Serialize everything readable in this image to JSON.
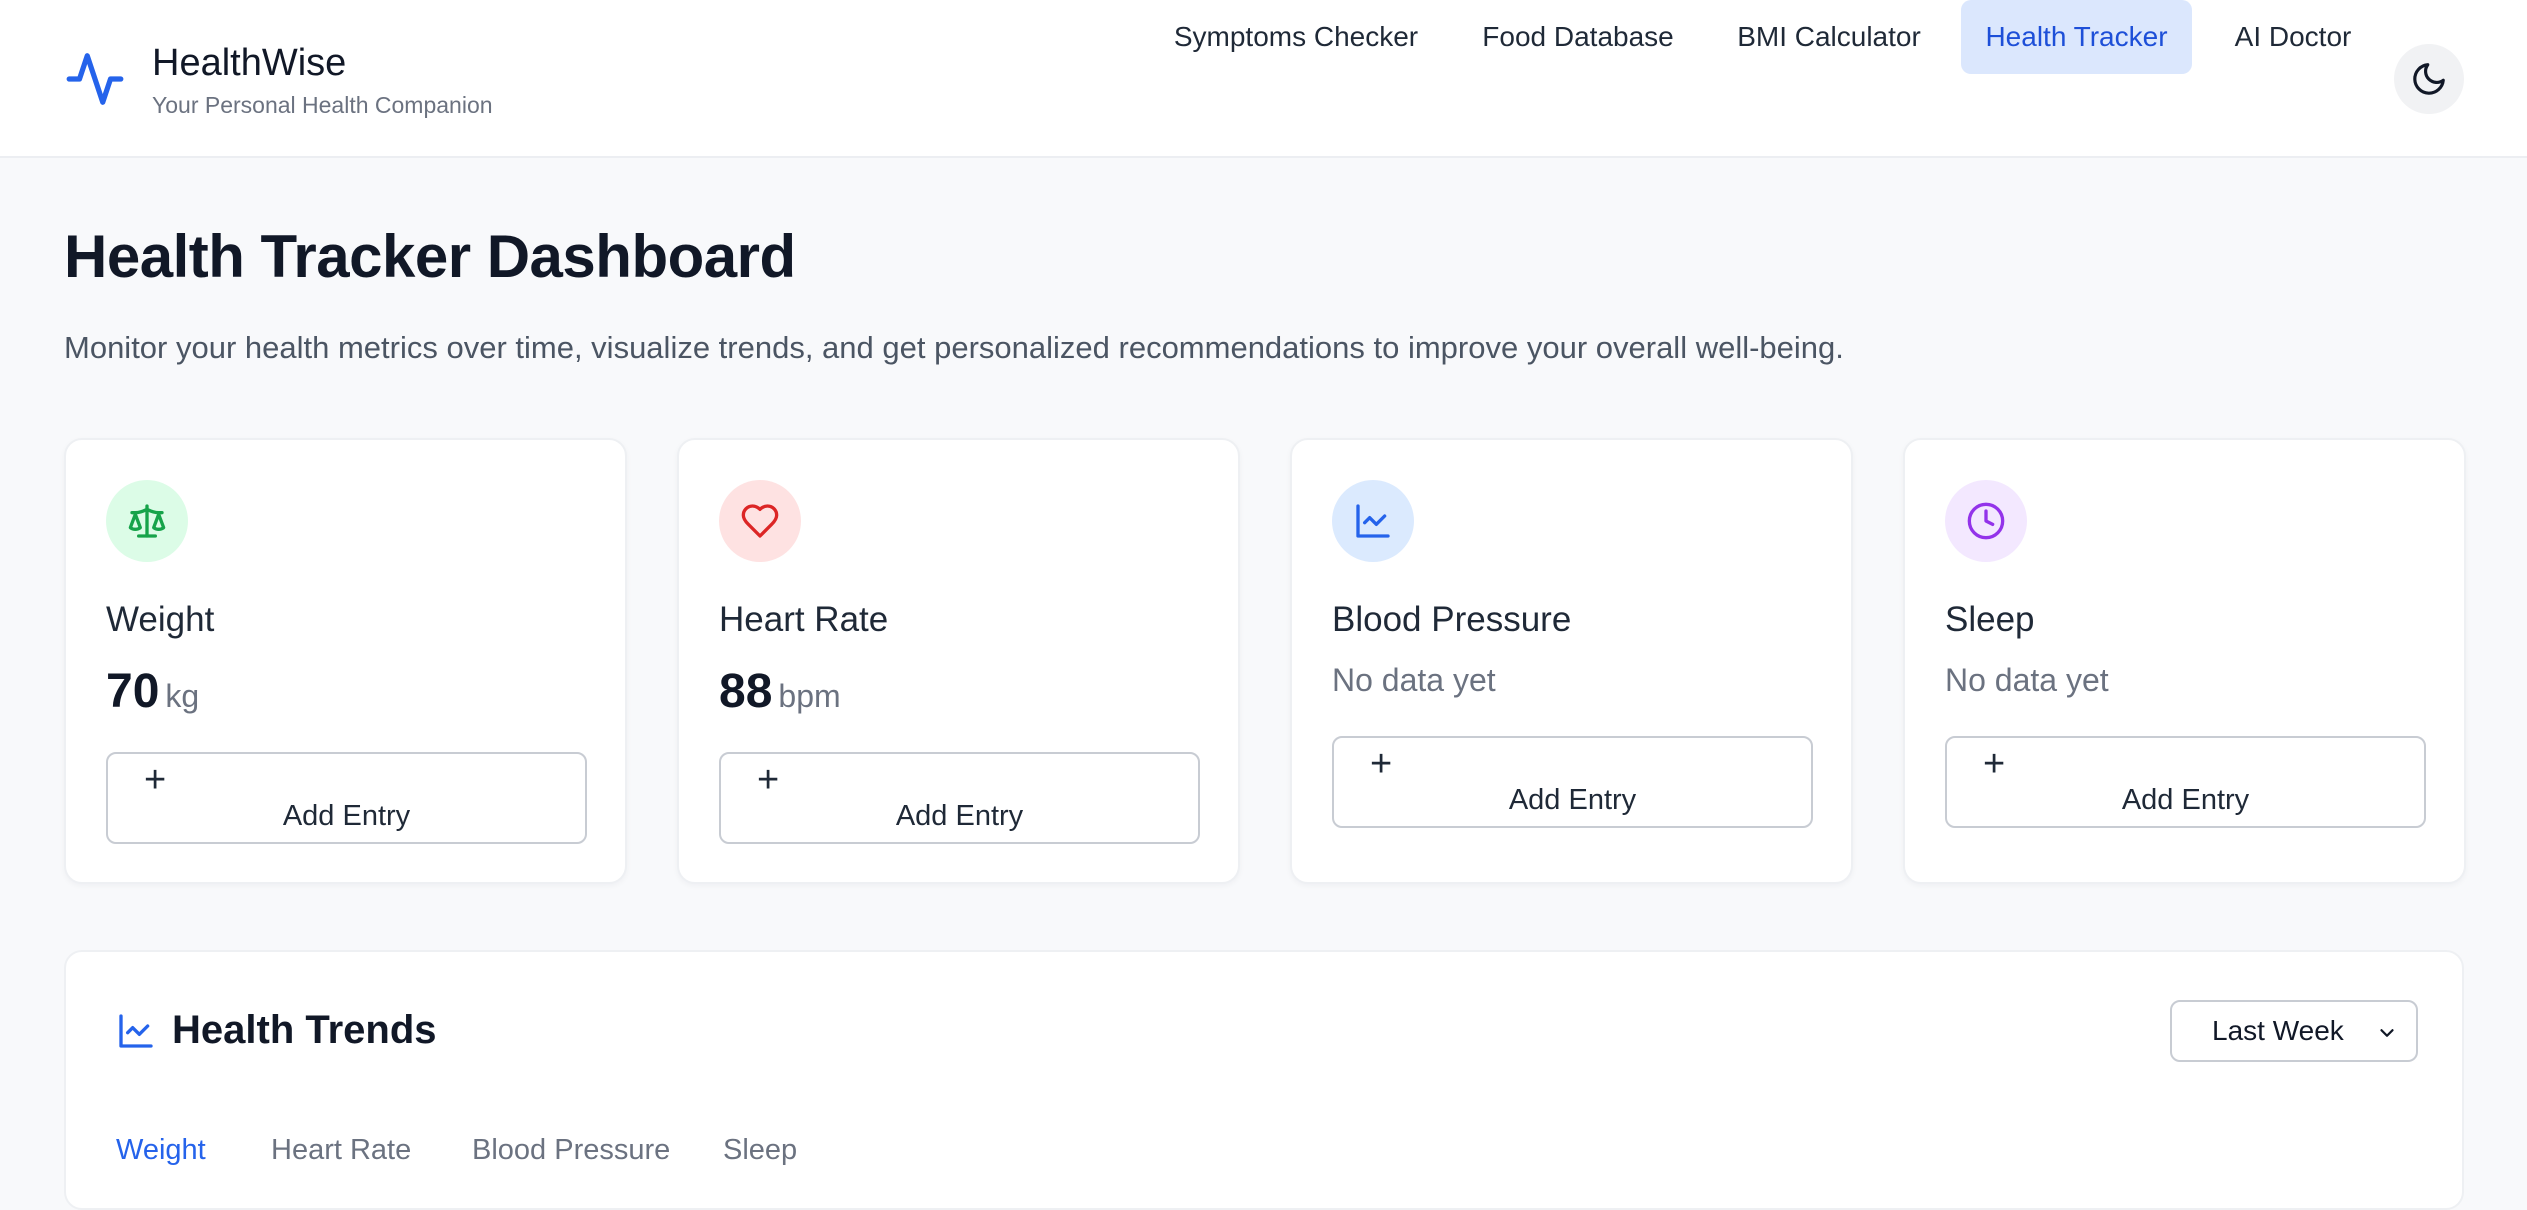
{
  "app": {
    "name": "HealthWise",
    "tagline": "Your Personal Health Companion"
  },
  "nav": {
    "items": [
      {
        "label": "Symptoms Checker",
        "active": false
      },
      {
        "label": "Food Database",
        "active": false
      },
      {
        "label": "BMI Calculator",
        "active": false
      },
      {
        "label": "Health Tracker",
        "active": true
      },
      {
        "label": "AI Doctor",
        "active": false
      }
    ],
    "theme_toggle_icon": "moon-icon"
  },
  "page": {
    "title": "Health Tracker Dashboard",
    "subtitle": "Monitor your health metrics over time, visualize trends, and get personalized recommendations to improve your overall well-being."
  },
  "metrics": [
    {
      "title": "Weight",
      "value": "70",
      "unit": "kg",
      "icon": "scale-icon",
      "icon_color": "#16a34a",
      "icon_bg": "#dcfce7",
      "button": "Add Entry"
    },
    {
      "title": "Heart Rate",
      "value": "88",
      "unit": "bpm",
      "icon": "heart-icon",
      "icon_color": "#dc2626",
      "icon_bg": "#fee2e2",
      "button": "Add Entry"
    },
    {
      "title": "Blood Pressure",
      "empty_text": "No data yet",
      "icon": "line-chart-icon",
      "icon_color": "#2563eb",
      "icon_bg": "#dbeafe",
      "button": "Add Entry"
    },
    {
      "title": "Sleep",
      "empty_text": "No data yet",
      "icon": "clock-icon",
      "icon_color": "#9333ea",
      "icon_bg": "#f3e8ff",
      "button": "Add Entry"
    }
  ],
  "trends": {
    "title": "Health Trends",
    "range": "Last Week",
    "tabs": [
      {
        "label": "Weight",
        "active": true
      },
      {
        "label": "Heart Rate",
        "active": false
      },
      {
        "label": "Blood Pressure",
        "active": false
      },
      {
        "label": "Sleep",
        "active": false
      }
    ]
  },
  "colors": {
    "accent": "#2563eb",
    "active_nav_bg": "#dbe7fd",
    "background": "#f8f9fb"
  }
}
